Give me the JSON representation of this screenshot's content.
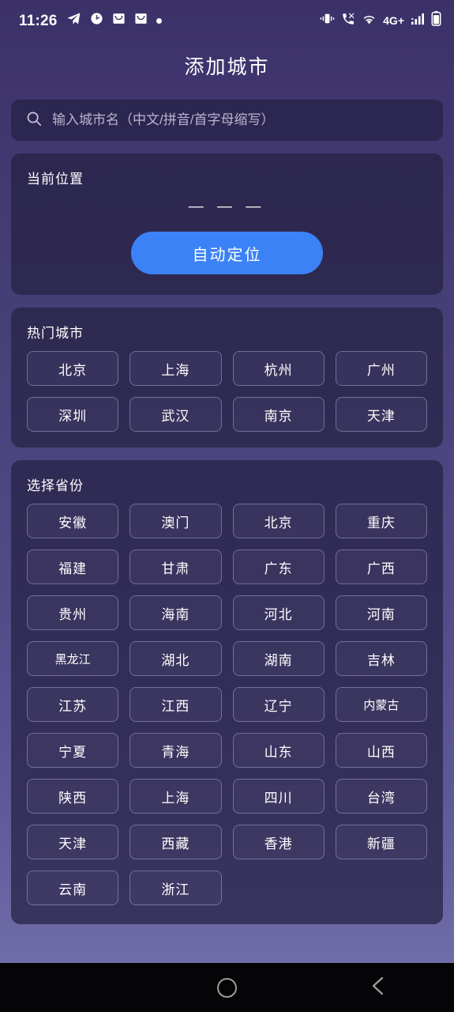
{
  "status_bar": {
    "time": "11:26",
    "left_icons": [
      "telegram-icon",
      "clock-icon",
      "mail-icon",
      "mail-icon",
      "dot-icon"
    ],
    "network_label": "4G+",
    "right_icons": [
      "vibrate-icon",
      "call-icon",
      "wifi-icon",
      "signal-icon",
      "battery-icon"
    ]
  },
  "header": {
    "title": "添加城市"
  },
  "search": {
    "placeholder": "输入城市名（中文/拼音/首字母缩写）",
    "value": "",
    "icon": "search-icon"
  },
  "location": {
    "title": "当前位置",
    "value": "— — —",
    "button_label": "自动定位",
    "button_color": "#3b82f6"
  },
  "hot_cities": {
    "title": "热门城市",
    "items": [
      "北京",
      "上海",
      "杭州",
      "广州",
      "深圳",
      "武汉",
      "南京",
      "天津"
    ]
  },
  "provinces": {
    "title": "选择省份",
    "items": [
      "安徽",
      "澳门",
      "北京",
      "重庆",
      "福建",
      "甘肃",
      "广东",
      "广西",
      "贵州",
      "海南",
      "河北",
      "河南",
      "黑龙江",
      "湖北",
      "湖南",
      "吉林",
      "江苏",
      "江西",
      "辽宁",
      "内蒙古",
      "宁夏",
      "青海",
      "山东",
      "山西",
      "陕西",
      "上海",
      "四川",
      "台湾",
      "天津",
      "西藏",
      "香港",
      "新疆",
      "云南",
      "浙江"
    ]
  },
  "nav_bar": {
    "recents_label": "recent-apps",
    "home_label": "home",
    "back_label": "back"
  },
  "theme": {
    "background_top": "#3b3168",
    "background_bottom": "#6f6ca8",
    "card_background": "#2a2448",
    "accent": "#3b82f6"
  }
}
